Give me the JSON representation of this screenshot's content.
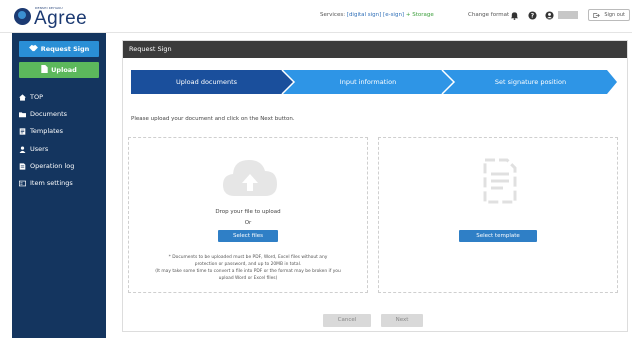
{
  "header": {
    "logo_small": "DENSHI KEIYAKU",
    "logo_text": "Agree",
    "services_label": "Services:",
    "service_sign": "[digital sign] [e-sign]",
    "service_storage": "+ Storage",
    "language": "Change format",
    "signout_label": "Sign out"
  },
  "sidebar": {
    "request_sign": "Request Sign",
    "upload": "Upload",
    "items": [
      {
        "label": "TOP",
        "icon": "home-icon"
      },
      {
        "label": "Documents",
        "icon": "folder-icon"
      },
      {
        "label": "Templates",
        "icon": "template-icon"
      },
      {
        "label": "Users",
        "icon": "user-icon"
      },
      {
        "label": "Operation log",
        "icon": "log-icon"
      },
      {
        "label": "Item settings",
        "icon": "settings-icon"
      }
    ]
  },
  "main": {
    "title": "Request Sign",
    "steps": [
      "Upload documents",
      "Input information",
      "Set signature position"
    ],
    "instruction": "Please upload your document and click on the Next button.",
    "upload_zone": {
      "drop_text": "Drop your file to upload",
      "or_text": "Or",
      "select_files": "Select files",
      "note_lines": [
        "* Documents to be uploaded must be PDF, Word, Excel files without any",
        "protection or password, and up to 20MB in total.",
        "(It may take some time to convert a file into PDF or the format may be broken if you",
        "upload Word or Excel files)"
      ]
    },
    "template_zone": {
      "select_template": "Select template"
    },
    "cancel": "Cancel",
    "next": "Next"
  },
  "colors": {
    "sidebar_bg": "#14355f",
    "step_active": "#1a4f9c",
    "step_inactive": "#2e95e6",
    "request_btn": "#2a8fd6",
    "upload_btn": "#5cb85c",
    "primary_btn": "#2f7fc6"
  }
}
